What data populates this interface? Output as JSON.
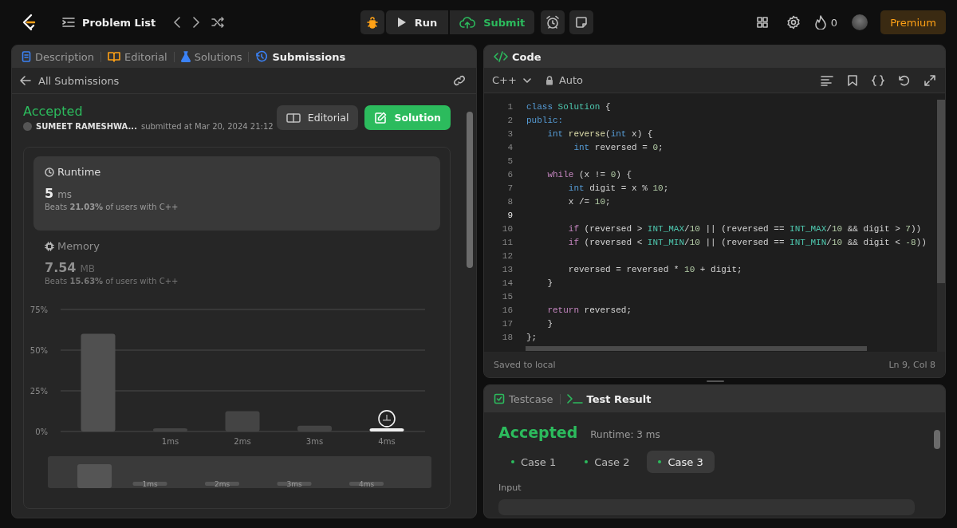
{
  "top_bar": {
    "problem_list": "Problem List",
    "run": "Run",
    "submit": "Submit",
    "streak": "0",
    "premium": "Premium"
  },
  "left_panel": {
    "tabs": [
      {
        "label": "Description",
        "selected": false
      },
      {
        "label": "Editorial",
        "selected": false
      },
      {
        "label": "Solutions",
        "selected": false
      },
      {
        "label": "Submissions",
        "selected": true
      }
    ],
    "back_link": "All Submissions",
    "submission": {
      "status": "Accepted",
      "author": "SUMEET RAMESHWA...",
      "submitted": "submitted at Mar 20, 2024 21:12",
      "buttons": [
        {
          "label": "Editorial",
          "kind": "secondary"
        },
        {
          "label": "Solution",
          "kind": "primary"
        }
      ]
    },
    "stats": [
      {
        "label": "Runtime",
        "value": "5",
        "unit": "ms",
        "beats": "Beats **21.03%** of users with C++",
        "selected": true
      },
      {
        "label": "Memory",
        "value": "7.54",
        "unit": "MB",
        "beats": "Beats **15.63%** of users with C++",
        "selected": false
      }
    ],
    "chart_data": {
      "type": "bar",
      "categories": [
        null,
        "1ms",
        "2ms",
        "3ms",
        "4ms"
      ],
      "values": [
        60,
        2,
        12.5,
        3.5,
        2
      ],
      "ylim": [
        0,
        75
      ],
      "yticks": [
        {
          "value": 0,
          "label": "0%"
        },
        {
          "value": 25,
          "label": "25%"
        },
        {
          "value": 50,
          "label": "50%"
        },
        {
          "value": 75,
          "label": "75%"
        }
      ],
      "annotations": [
        {
          "x": "4ms"
        }
      ]
    },
    "overview_labels": [
      "1ms",
      "2ms",
      "3ms",
      "4ms"
    ]
  },
  "code_panel": {
    "title": "Code",
    "language": "C++",
    "mode": "Auto",
    "lines": [
      {
        "number": "1",
        "current": false,
        "tokens": [
          {
            "text": "class ",
            "kind": "kw"
          },
          {
            "text": "Solution",
            "kind": "type"
          },
          {
            "text": " {",
            "kind": "plain"
          }
        ]
      },
      {
        "number": "2",
        "current": false,
        "tokens": [
          {
            "text": "public:",
            "kind": "kw"
          }
        ]
      },
      {
        "number": "3",
        "current": false,
        "tokens": [
          {
            "text": "    int ",
            "kind": "kw"
          },
          {
            "text": "reverse",
            "kind": "fn"
          },
          {
            "text": "(",
            "kind": "plain"
          },
          {
            "text": "int ",
            "kind": "kw"
          },
          {
            "text": "x",
            "kind": "var"
          },
          {
            "text": ") {",
            "kind": "plain"
          }
        ]
      },
      {
        "number": "4",
        "current": false,
        "tokens": [
          {
            "text": "         int ",
            "kind": "kw"
          },
          {
            "text": "reversed = ",
            "kind": "var"
          },
          {
            "text": "0",
            "kind": "num"
          },
          {
            "text": ";",
            "kind": "plain"
          }
        ]
      },
      {
        "number": "5",
        "current": false
      },
      {
        "number": "6",
        "current": false,
        "tokens": [
          {
            "text": "    while",
            "kind": "ctrl"
          },
          {
            "text": " (x != ",
            "kind": "plain"
          },
          {
            "text": "0",
            "kind": "num"
          },
          {
            "text": ") {",
            "kind": "plain"
          }
        ]
      },
      {
        "number": "7",
        "current": false,
        "tokens": [
          {
            "text": "        int ",
            "kind": "kw"
          },
          {
            "text": "digit = x % ",
            "kind": "var"
          },
          {
            "text": "10",
            "kind": "num"
          },
          {
            "text": ";",
            "kind": "plain"
          }
        ]
      },
      {
        "number": "8",
        "current": false,
        "tokens": [
          {
            "text": "        x /= ",
            "kind": "var"
          },
          {
            "text": "10",
            "kind": "num"
          },
          {
            "text": ";",
            "kind": "plain"
          }
        ]
      },
      {
        "number": "9",
        "current": true
      },
      {
        "number": "10",
        "current": false,
        "tokens": [
          {
            "text": "        if",
            "kind": "ctrl"
          },
          {
            "text": " (reversed > ",
            "kind": "var"
          },
          {
            "text": "INT_MAX",
            "kind": "type"
          },
          {
            "text": "/",
            "kind": "plain"
          },
          {
            "text": "10",
            "kind": "num"
          },
          {
            "text": " || (reversed == ",
            "kind": "var"
          },
          {
            "text": "INT_MAX",
            "kind": "type"
          },
          {
            "text": "/",
            "kind": "plain"
          },
          {
            "text": "10",
            "kind": "num"
          },
          {
            "text": " && digit > ",
            "kind": "var"
          },
          {
            "text": "7",
            "kind": "num"
          },
          {
            "text": "))",
            "kind": "plain"
          }
        ]
      },
      {
        "number": "11",
        "current": false,
        "tokens": [
          {
            "text": "        if",
            "kind": "ctrl"
          },
          {
            "text": " (reversed < ",
            "kind": "var"
          },
          {
            "text": "INT_MIN",
            "kind": "type"
          },
          {
            "text": "/",
            "kind": "plain"
          },
          {
            "text": "10",
            "kind": "num"
          },
          {
            "text": " || (reversed == ",
            "kind": "var"
          },
          {
            "text": "INT_MIN",
            "kind": "type"
          },
          {
            "text": "/",
            "kind": "plain"
          },
          {
            "text": "10",
            "kind": "num"
          },
          {
            "text": " && digit < ",
            "kind": "var"
          },
          {
            "text": "-8",
            "kind": "num"
          },
          {
            "text": "))",
            "kind": "plain"
          }
        ]
      },
      {
        "number": "12",
        "current": false
      },
      {
        "number": "13",
        "current": false,
        "tokens": [
          {
            "text": "        reversed = reversed * ",
            "kind": "var"
          },
          {
            "text": "10",
            "kind": "num"
          },
          {
            "text": " + digit;",
            "kind": "var"
          }
        ]
      },
      {
        "number": "14",
        "current": false,
        "tokens": [
          {
            "text": "    }",
            "kind": "plain"
          }
        ]
      },
      {
        "number": "15",
        "current": false
      },
      {
        "number": "16",
        "current": false,
        "tokens": [
          {
            "text": "    return",
            "kind": "ctrl"
          },
          {
            "text": " reversed;",
            "kind": "var"
          }
        ]
      },
      {
        "number": "17",
        "current": false,
        "tokens": [
          {
            "text": "    }",
            "kind": "plain"
          }
        ]
      },
      {
        "number": "18",
        "current": false,
        "tokens": [
          {
            "text": "};",
            "kind": "plain"
          }
        ]
      }
    ],
    "status": "Saved to local",
    "cursor": "Ln 9, Col 8"
  },
  "test_panel": {
    "tabs": [
      {
        "label": "Testcase",
        "selected": false
      },
      {
        "label": "Test Result",
        "selected": true
      }
    ],
    "status": "Accepted",
    "runtime": "Runtime: 3 ms",
    "cases": [
      {
        "label": "Case 1",
        "selected": false
      },
      {
        "label": "Case 2",
        "selected": false
      },
      {
        "label": "Case 3",
        "selected": true
      }
    ],
    "input_label": "Input"
  }
}
